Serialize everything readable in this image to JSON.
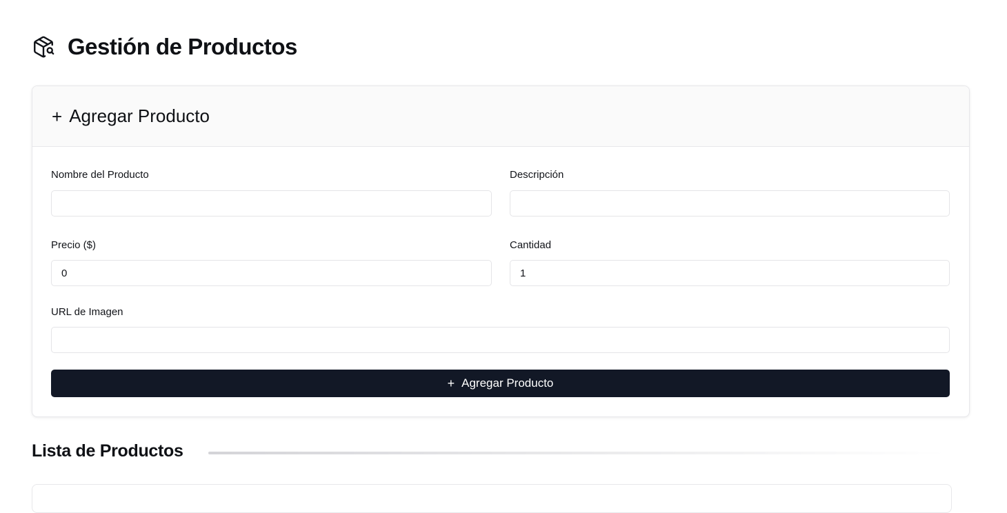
{
  "header": {
    "title": "Gestión de Productos",
    "icon": "package-search-icon"
  },
  "form": {
    "title": "Agregar Producto",
    "title_icon": "plus-icon",
    "fields": {
      "name": {
        "label": "Nombre del Producto",
        "value": ""
      },
      "description": {
        "label": "Descripción",
        "value": ""
      },
      "price": {
        "label": "Precio ($)",
        "value": "0"
      },
      "quantity": {
        "label": "Cantidad",
        "value": "1"
      },
      "image_url": {
        "label": "URL de Imagen",
        "value": ""
      }
    },
    "submit_label": "Agregar Producto",
    "submit_color": "#121826"
  },
  "list": {
    "title": "Lista de Productos"
  }
}
